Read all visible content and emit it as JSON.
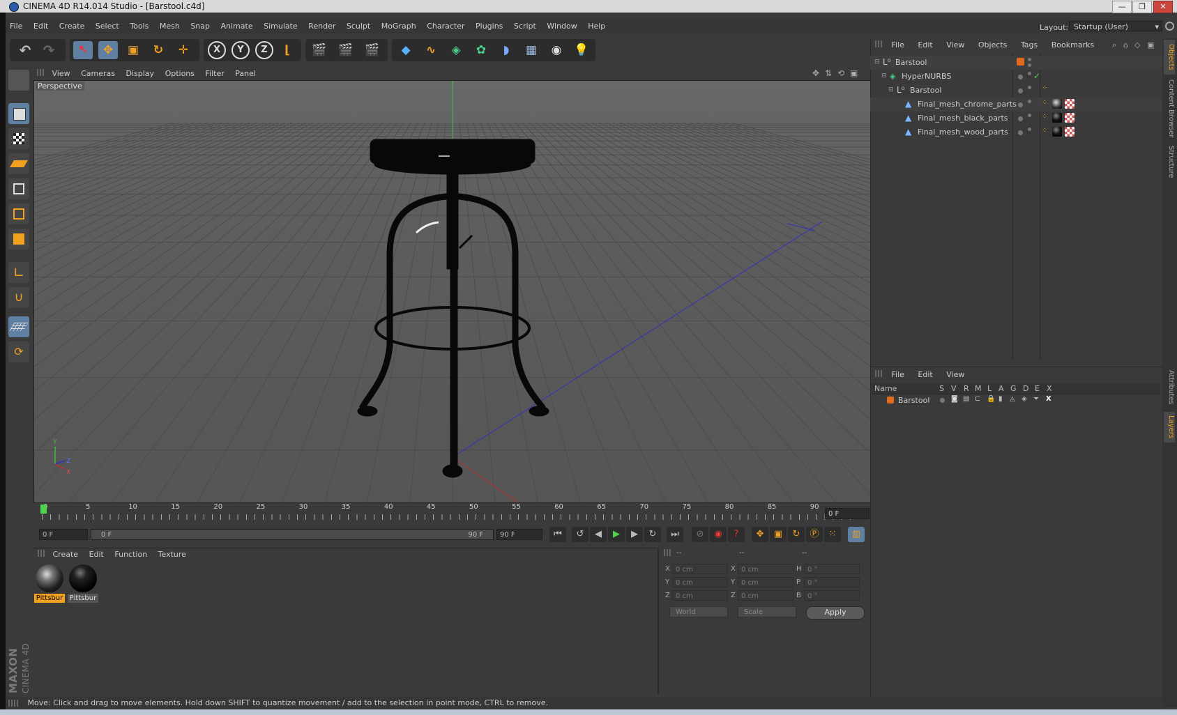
{
  "window": {
    "title": "CINEMA 4D R14.014 Studio - [Barstool.c4d]",
    "minimize": "—",
    "restore": "❐",
    "close": "✕"
  },
  "menubar": {
    "items": [
      "File",
      "Edit",
      "Create",
      "Select",
      "Tools",
      "Mesh",
      "Snap",
      "Animate",
      "Simulate",
      "Render",
      "Sculpt",
      "MoGraph",
      "Character",
      "Plugins",
      "Script",
      "Window",
      "Help"
    ],
    "layout_label": "Layout:",
    "layout_value": "Startup (User)"
  },
  "toolbar": {
    "axis_x": "X",
    "axis_y": "Y",
    "axis_z": "Z"
  },
  "viewport": {
    "menu": [
      "View",
      "Cameras",
      "Display",
      "Options",
      "Filter",
      "Panel"
    ],
    "label": "Perspective",
    "axis_y": "Y",
    "axis_z": "Z",
    "axis_x": "X"
  },
  "timeline": {
    "ticks": [
      "0",
      "5",
      "10",
      "15",
      "20",
      "25",
      "30",
      "35",
      "40",
      "45",
      "50",
      "55",
      "60",
      "65",
      "70",
      "75",
      "80",
      "85",
      "90"
    ],
    "current_frame": "0 F",
    "start_field": "0 F",
    "range_start": "0 F",
    "range_end": "90 F",
    "end_field": "90 F"
  },
  "materials": {
    "menu": [
      "Create",
      "Edit",
      "Function",
      "Texture"
    ],
    "items": [
      {
        "label": "Pittsbur",
        "selected": true
      },
      {
        "label": "Pittsbur",
        "selected": false
      }
    ]
  },
  "coords": {
    "headers": [
      "--",
      "--",
      "--"
    ],
    "rows": [
      {
        "a": "X",
        "av": "0 cm",
        "b": "X",
        "bv": "0 cm",
        "c": "H",
        "cv": "0 °"
      },
      {
        "a": "Y",
        "av": "0 cm",
        "b": "Y",
        "bv": "0 cm",
        "c": "P",
        "cv": "0 °"
      },
      {
        "a": "Z",
        "av": "0 cm",
        "b": "Z",
        "bv": "0 cm",
        "c": "B",
        "cv": "0 °"
      }
    ],
    "mode": "World",
    "size_mode": "Scale",
    "apply": "Apply"
  },
  "object_manager": {
    "menu": [
      "File",
      "Edit",
      "View",
      "Objects",
      "Tags",
      "Bookmarks"
    ],
    "objects": [
      {
        "name": "Barstool",
        "level": 0
      },
      {
        "name": "HyperNURBS",
        "level": 1
      },
      {
        "name": "Barstool",
        "level": 2
      },
      {
        "name": "Final_mesh_chrome_parts",
        "level": 3
      },
      {
        "name": "Final_mesh_black_parts",
        "level": 3
      },
      {
        "name": "Final_mesh_wood_parts",
        "level": 3
      }
    ]
  },
  "layer_manager": {
    "menu": [
      "File",
      "Edit",
      "View"
    ],
    "headers": [
      "Name",
      "S",
      "V",
      "R",
      "M",
      "L",
      "A",
      "G",
      "D",
      "E",
      "X"
    ],
    "layers": [
      {
        "name": "Barstool",
        "color": "#e06a1e"
      }
    ]
  },
  "right_tabs": [
    "Objects",
    "Content Browser",
    "Structure",
    "Attributes",
    "Layers"
  ],
  "statusbar": {
    "text": "Move: Click and drag to move elements. Hold down SHIFT to quantize movement / add to the selection in point mode, CTRL to remove."
  },
  "branding": {
    "maxon": "MAXON",
    "cinema": "CINEMA 4D"
  },
  "colors": {
    "accent_orange": "#f2a11f",
    "selection_blue": "#5f7fa3",
    "layer_orange": "#e06a1e"
  }
}
